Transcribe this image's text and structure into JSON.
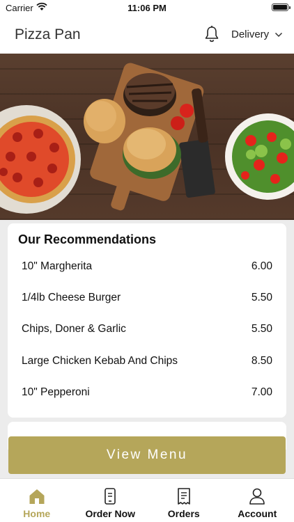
{
  "status_bar": {
    "carrier": "Carrier",
    "time": "11:06 PM"
  },
  "header": {
    "title": "Pizza Pan",
    "delivery_label": "Delivery"
  },
  "recommendations": {
    "title": "Our Recommendations",
    "items": [
      {
        "name": "10\" Margherita",
        "price": "6.00"
      },
      {
        "name": "1/4lb Cheese Burger",
        "price": "5.50"
      },
      {
        "name": "Chips, Doner & Garlic",
        "price": "5.50"
      },
      {
        "name": "Large Chicken Kebab And Chips",
        "price": "8.50"
      },
      {
        "name": "10\" Pepperoni",
        "price": "7.00"
      }
    ]
  },
  "view_menu_label": "View Menu",
  "tabs": [
    {
      "label": "Home",
      "icon": "home-icon",
      "active": true
    },
    {
      "label": "Order Now",
      "icon": "phone-order-icon",
      "active": false
    },
    {
      "label": "Orders",
      "icon": "receipt-icon",
      "active": false
    },
    {
      "label": "Account",
      "icon": "user-icon",
      "active": false
    }
  ],
  "colors": {
    "accent": "#b5a65a",
    "background": "#ececec"
  }
}
